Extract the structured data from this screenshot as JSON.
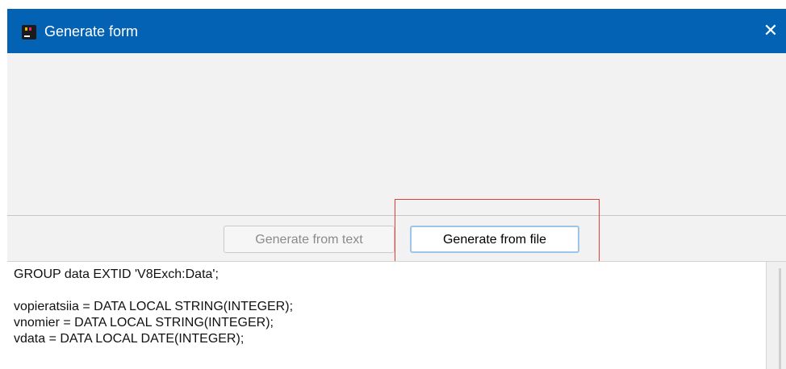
{
  "window": {
    "title": "Generate form",
    "icon": "intellij-app-icon",
    "close_label": "✕",
    "titlebar_color": "#0462b4"
  },
  "buttons": {
    "generate_from_text": "Generate from text",
    "generate_from_file": "Generate from file"
  },
  "highlight_color": "#e33c3c",
  "editor": {
    "lines": [
      "GROUP data EXTID 'V8Exch:Data';",
      "",
      "vopieratsiia = DATA LOCAL STRING(INTEGER);",
      "vnomier = DATA LOCAL STRING(INTEGER);",
      "vdata = DATA LOCAL DATE(INTEGER);"
    ]
  }
}
